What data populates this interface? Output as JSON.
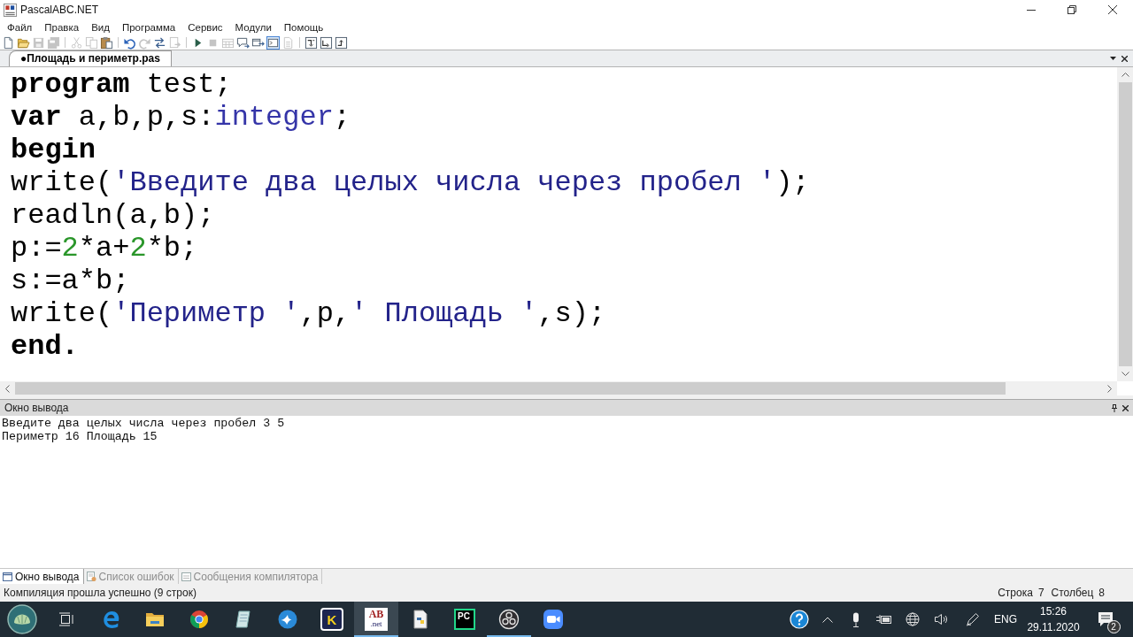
{
  "window": {
    "title": "PascalABC.NET"
  },
  "menu": [
    "Файл",
    "Правка",
    "Вид",
    "Программа",
    "Сервис",
    "Модули",
    "Помощь"
  ],
  "toolbar": [
    {
      "buttons": [
        {
          "disabled": false,
          "checked": false
        },
        {
          "disabled": false,
          "checked": false
        },
        {
          "disabled": true,
          "checked": false
        },
        {
          "disabled": true,
          "checked": false
        }
      ]
    },
    {
      "buttons": [
        {
          "disabled": true,
          "checked": false
        },
        {
          "disabled": true,
          "checked": false
        },
        {
          "disabled": false,
          "checked": false
        }
      ]
    },
    {
      "buttons": [
        {
          "disabled": false,
          "checked": false
        },
        {
          "disabled": true,
          "checked": false
        },
        {
          "disabled": false,
          "checked": false
        },
        {
          "disabled": true,
          "checked": false
        }
      ]
    },
    {
      "buttons": [
        {
          "disabled": false,
          "checked": false
        },
        {
          "disabled": true,
          "checked": false
        },
        {
          "disabled": true,
          "checked": false
        },
        {
          "disabled": false,
          "checked": false
        },
        {
          "disabled": false,
          "checked": false
        },
        {
          "disabled": false,
          "checked": true
        },
        {
          "disabled": true,
          "checked": false
        }
      ]
    },
    {
      "buttons": [
        {
          "disabled": false,
          "checked": false
        },
        {
          "disabled": false,
          "checked": false
        },
        {
          "disabled": false,
          "checked": false
        }
      ]
    }
  ],
  "editor": {
    "tabs": [
      {
        "title": "●Площадь и периметр.pas",
        "selected": true
      }
    ],
    "lines": [
      [
        {
          "kind": "keyword",
          "text": "program"
        },
        {
          "kind": "plain",
          "text": " test;"
        }
      ],
      [
        {
          "kind": "keyword",
          "text": "var"
        },
        {
          "kind": "plain",
          "text": " a,b,p,s:"
        },
        {
          "kind": "type",
          "text": "integer"
        },
        {
          "kind": "plain",
          "text": ";"
        }
      ],
      [
        {
          "kind": "keyword",
          "text": "begin"
        }
      ],
      [
        {
          "kind": "plain",
          "text": "write("
        },
        {
          "kind": "string",
          "text": "'Введите два целых числа через пробел '"
        },
        {
          "kind": "plain",
          "text": ");"
        }
      ],
      [
        {
          "kind": "plain",
          "text": "readln(a,b);"
        }
      ],
      [
        {
          "kind": "plain",
          "text": "p:="
        },
        {
          "kind": "number",
          "text": "2"
        },
        {
          "kind": "plain",
          "text": "*a+"
        },
        {
          "kind": "number",
          "text": "2"
        },
        {
          "kind": "plain",
          "text": "*b;"
        }
      ],
      [
        {
          "kind": "plain",
          "text": "s:=a*b;"
        }
      ],
      [
        {
          "kind": "plain",
          "text": "write("
        },
        {
          "kind": "string",
          "text": "'Периметр '"
        },
        {
          "kind": "plain",
          "text": ",p,"
        },
        {
          "kind": "string",
          "text": "' Площадь '"
        },
        {
          "kind": "plain",
          "text": ",s);"
        }
      ],
      [
        {
          "kind": "keyword",
          "text": "end."
        }
      ]
    ]
  },
  "output": {
    "title": "Окно вывода",
    "lines": [
      "Введите два целых числа через пробел 3 5",
      "Периметр 16 Площадь 15"
    ]
  },
  "bottom_tabs": [
    {
      "label": "Окно вывода",
      "selected": true
    },
    {
      "label": "Список ошибок",
      "selected": false
    },
    {
      "label": "Сообщения компилятора",
      "selected": false
    }
  ],
  "status_bar": {
    "message": "Компиляция прошла успешно (9 строк)",
    "position": [
      {
        "label": "Строка",
        "value": "7"
      },
      {
        "label": "Столбец",
        "value": "8"
      }
    ]
  },
  "taskbar": {
    "apps": [
      {
        "active": false,
        "running": false
      },
      {
        "active": false,
        "running": false
      },
      {
        "active": false,
        "running": false
      },
      {
        "active": false,
        "running": false
      },
      {
        "active": false,
        "running": false
      },
      {
        "active": false,
        "running": false,
        "glyph_lines": [
          "K"
        ]
      },
      {
        "active": true,
        "running": true,
        "glyph_lines": [
          "AB",
          ".net"
        ]
      },
      {
        "active": false,
        "running": false
      },
      {
        "active": false,
        "running": false,
        "glyph_lines": [
          "PC"
        ]
      },
      {
        "active": false,
        "running": true
      },
      {
        "active": false,
        "running": false
      }
    ],
    "tray": {
      "language": "ENG",
      "time": "15:26",
      "date": "29.11.2020",
      "notifications": "2"
    }
  }
}
